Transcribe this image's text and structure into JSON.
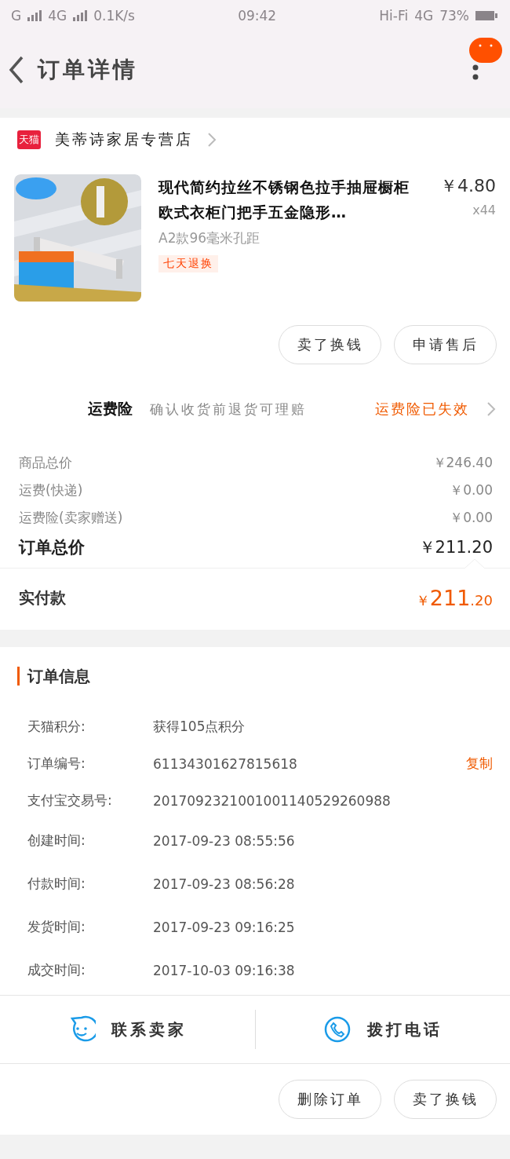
{
  "status_bar": {
    "network_1": "G",
    "network_2": "4G",
    "speed": "0.1K/s",
    "time": "09:42",
    "hifi": "Hi-Fi",
    "network_3": "4G",
    "battery": "73%"
  },
  "header": {
    "title": "订单详情"
  },
  "shop": {
    "badge": "天猫",
    "name": "美蒂诗家居专营店"
  },
  "product": {
    "kind": "picture",
    "title": "现代简约拉丝不锈钢色拉手抽屉橱柜欧式衣柜门把手五金隐形…",
    "sku": "A2款96毫米孔距",
    "tag": "七天退换",
    "price": "￥4.80",
    "quantity": "x44"
  },
  "item_buttons": [
    "卖了换钱",
    "申请售后"
  ],
  "insurance": {
    "label": "运费险",
    "description": "确认收货前退货可理赔",
    "status": "运费险已失效"
  },
  "fees": [
    {
      "label": "商品总价",
      "value": "￥246.40"
    },
    {
      "label": "运费(快递)",
      "value": "￥0.00"
    },
    {
      "label": "运费险(卖家赠送)",
      "value": "￥0.00"
    }
  ],
  "total": {
    "label": "订单总价",
    "value": "￥211.20"
  },
  "paid": {
    "label": "实付款",
    "currency": "￥",
    "integer": "211",
    "decimal": ".20"
  },
  "order_info": {
    "title": "订单信息",
    "rows": [
      {
        "label": "天猫积分:",
        "value": "获得105点积分"
      },
      {
        "label": "订单编号:",
        "value": "61134301627815618",
        "action": "复制"
      },
      {
        "label": "支付宝交易号:",
        "value": "2017092321001001140529260988"
      },
      {
        "label": "创建时间:",
        "value": "2017-09-23 08:55:56"
      },
      {
        "label": "付款时间:",
        "value": "2017-09-23 08:56:28"
      },
      {
        "label": "发货时间:",
        "value": "2017-09-23 09:16:25"
      },
      {
        "label": "成交时间:",
        "value": "2017-10-03 09:16:38"
      }
    ]
  },
  "contact_bar": [
    {
      "kind": "chat",
      "label": "联系卖家"
    },
    {
      "kind": "phone",
      "label": "拨打电话"
    }
  ],
  "bottom_buttons": [
    "删除订单",
    "卖了换钱"
  ]
}
